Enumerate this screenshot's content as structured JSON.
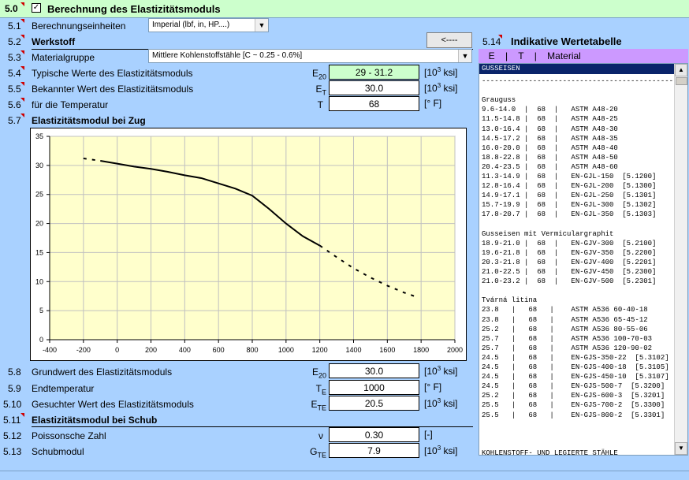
{
  "header": {
    "number": "5.0",
    "title": "Berechnung des Elastizitätsmoduls"
  },
  "rows": {
    "r51": {
      "num": "5.1",
      "label": "Berechnungseinheiten",
      "select": "Imperial (lbf, in, HP....)"
    },
    "r52": {
      "num": "5.2",
      "label": "Werkstoff",
      "back_button": "<----"
    },
    "r53": {
      "num": "5.3",
      "label": "Materialgruppe",
      "select": "Mittlere Kohlenstoffstähle   [C ~ 0.25 - 0.6%]"
    },
    "r54": {
      "num": "5.4",
      "label": "Typische Werte des Elastizitätsmoduls",
      "sym_main": "E",
      "sym_sub": "20",
      "value": "29 - 31.2",
      "unit_pre": "[10",
      "unit_sup": "3",
      "unit_post": " ksi]"
    },
    "r55": {
      "num": "5.5",
      "label": "Bekannter Wert des Elastizitätsmoduls",
      "sym_main": "E",
      "sym_sub": "T",
      "value": "30.0",
      "unit_pre": "[10",
      "unit_sup": "3",
      "unit_post": " ksi]"
    },
    "r56": {
      "num": "5.6",
      "label": "für die Temperatur",
      "sym_main": "T",
      "value": "68",
      "unit": "[° F]"
    },
    "r57": {
      "num": "5.7",
      "label": "Elastizitätsmodul bei Zug"
    },
    "r58": {
      "num": "5.8",
      "label": "Grundwert des Elastizitätsmoduls",
      "sym_main": "E",
      "sym_sub": "20",
      "value": "30.0",
      "unit_pre": "[10",
      "unit_sup": "3",
      "unit_post": " ksi]"
    },
    "r59": {
      "num": "5.9",
      "label": "Endtemperatur",
      "sym_main": "T",
      "sym_sub": "E",
      "value": "1000",
      "unit": "[° F]"
    },
    "r510": {
      "num": "5.10",
      "label": "Gesuchter Wert des Elastizitätsmoduls",
      "sym_main": "E",
      "sym_sub": "TE",
      "value": "20.5",
      "unit_pre": "[10",
      "unit_sup": "3",
      "unit_post": " ksi]"
    },
    "r511": {
      "num": "5.11",
      "label": "Elastizitätsmodul bei Schub"
    },
    "r512": {
      "num": "5.12",
      "label": "Poissonsche Zahl",
      "sym_main": "ν",
      "value": "0.30",
      "unit": "[-]"
    },
    "r513": {
      "num": "5.13",
      "label": "Schubmodul",
      "sym_main": "G",
      "sym_sub": "TE",
      "value": "7.9",
      "unit_pre": "[10",
      "unit_sup": "3",
      "unit_post": " ksi]"
    }
  },
  "table": {
    "num": "5.14",
    "title": "Indikative Wertetabelle",
    "head": "  E    |    T    |    Material",
    "selected": "GUSSEISEN",
    "lines": [
      "-----------------------------------------------",
      "",
      "Grauguss",
      "9.6-14.0  |  68  |   ASTM A48-20",
      "11.5-14.8 |  68  |   ASTM A48-25",
      "13.0-16.4 |  68  |   ASTM A48-30",
      "14.5-17.2 |  68  |   ASTM A48-35",
      "16.0-20.0 |  68  |   ASTM A48-40",
      "18.8-22.8 |  68  |   ASTM A48-50",
      "20.4-23.5 |  68  |   ASTM A48-60",
      "11.3-14.9 |  68  |   EN-GJL-150  [5.1200]",
      "12.8-16.4 |  68  |   EN-GJL-200  [5.1300]",
      "14.9-17.1 |  68  |   EN-GJL-250  [5.1301]",
      "15.7-19.9 |  68  |   EN-GJL-300  [5.1302]",
      "17.8-20.7 |  68  |   EN-GJL-350  [5.1303]",
      "",
      "Gusseisen mit Vermiculargraphit",
      "18.9-21.0 |  68  |   EN-GJV-300  [5.2100]",
      "19.6-21.8 |  68  |   EN-GJV-350  [5.2200]",
      "20.3-21.8 |  68  |   EN-GJV-400  [5.2201]",
      "21.0-22.5 |  68  |   EN-GJV-450  [5.2300]",
      "21.0-23.2 |  68  |   EN-GJV-500  [5.2301]",
      "",
      "Tvárná litina",
      "23.8   |   68   |    ASTM A536 60-40-18",
      "23.8   |   68   |    ASTM A536 65-45-12",
      "25.2   |   68   |    ASTM A536 80-55-06",
      "25.7   |   68   |    ASTM A536 100-70-03",
      "25.7   |   68   |    ASTM A536 120-90-02",
      "24.5   |   68   |    EN-GJS-350-22  [5.3102]",
      "24.5   |   68   |    EN-GJS-400-18  [5.3105]",
      "24.5   |   68   |    EN-GJS-450-10  [5.3107]",
      "24.5   |   68   |    EN-GJS-500-7  [5.3200]",
      "25.2   |   68   |    EN-GJS-600-3  [5.3201]",
      "25.5   |   68   |    EN-GJS-700-2  [5.3300]",
      "25.5   |   68   |    EN-GJS-800-2  [5.3301]",
      "",
      "",
      "",
      "KOHLENSTOFF- UND LEGIERTE STÄHLE",
      "-----------------------------------------------"
    ]
  },
  "chart_data": {
    "type": "line",
    "title": "",
    "xlabel": "",
    "ylabel": "",
    "xlim": [
      -400,
      2000
    ],
    "ylim": [
      0,
      35
    ],
    "xticks": [
      -400,
      -200,
      0,
      200,
      400,
      600,
      800,
      1000,
      1200,
      1400,
      1600,
      1800,
      2000
    ],
    "yticks": [
      0,
      5,
      10,
      15,
      20,
      25,
      30,
      35
    ],
    "plot_background": "#ffffcc",
    "grid": true,
    "series": [
      {
        "style": "dashed",
        "x": [
          -200,
          -100
        ],
        "y": [
          31.2,
          30.8
        ]
      },
      {
        "style": "solid",
        "x": [
          -100,
          0,
          100,
          200,
          300,
          400,
          500,
          600,
          700,
          800,
          900,
          1000,
          1100,
          1200
        ],
        "y": [
          30.8,
          30.3,
          29.8,
          29.4,
          28.9,
          28.3,
          27.8,
          26.9,
          26.0,
          24.8,
          22.5,
          20.0,
          17.8,
          16.2
        ]
      },
      {
        "style": "dashed",
        "x": [
          1200,
          1300,
          1400,
          1500,
          1600,
          1700,
          1770
        ],
        "y": [
          16.2,
          14.2,
          12.3,
          10.7,
          9.3,
          8.1,
          7.4
        ]
      }
    ]
  },
  "colors": {
    "accent_green": "#ccffcc",
    "panel_blue": "#a9d1ff",
    "selection": "#0a246a",
    "plot_bg": "#ffffcc",
    "header_purple": "#cc99ff",
    "marker_red": "#d00000"
  }
}
